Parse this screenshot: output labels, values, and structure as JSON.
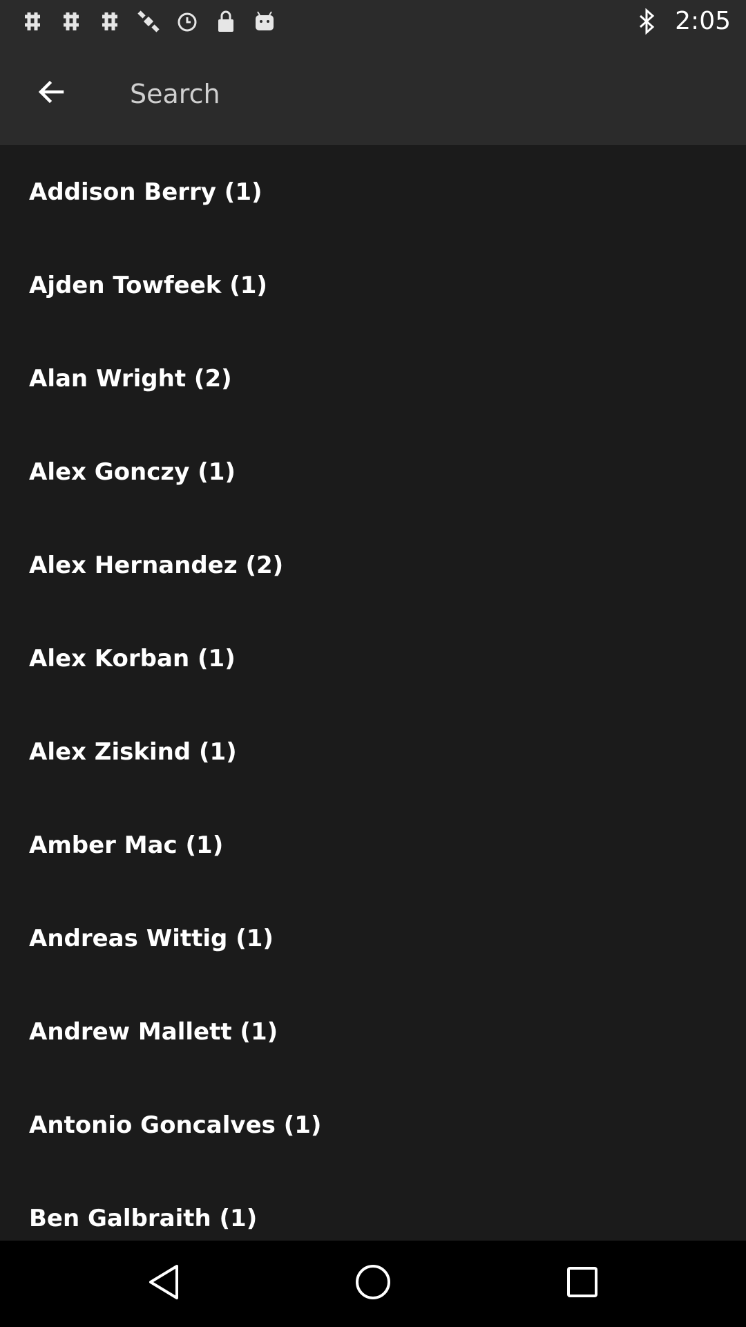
{
  "status_bar": {
    "time": "2:05",
    "left_icons": [
      "hashtag-icon",
      "hashtag-icon",
      "hashtag-icon",
      "satellite-icon",
      "alarm-icon",
      "lock-icon",
      "android-icon"
    ],
    "right_icons": [
      "bluetooth-icon"
    ]
  },
  "toolbar": {
    "back_icon": "arrow-back-icon",
    "search_placeholder": "Search"
  },
  "list": {
    "items": [
      {
        "label": "Addison Berry (1)"
      },
      {
        "label": "Ajden Towfeek (1)"
      },
      {
        "label": "Alan Wright (2)"
      },
      {
        "label": "Alex Gonczy (1)"
      },
      {
        "label": "Alex Hernandez (2)"
      },
      {
        "label": "Alex Korban (1)"
      },
      {
        "label": "Alex Ziskind (1)"
      },
      {
        "label": "Amber Mac (1)"
      },
      {
        "label": "Andreas Wittig (1)"
      },
      {
        "label": "Andrew Mallett (1)"
      },
      {
        "label": "Antonio Goncalves (1)"
      },
      {
        "label": "Ben Galbraith (1)"
      }
    ]
  },
  "nav_bar": {
    "icons": [
      "back-triangle-icon",
      "home-circle-icon",
      "recents-square-icon"
    ]
  },
  "colors": {
    "background": "#1b1b1b",
    "toolbar": "#2b2b2b",
    "nav_bar": "#000000",
    "text": "#ffffff"
  }
}
